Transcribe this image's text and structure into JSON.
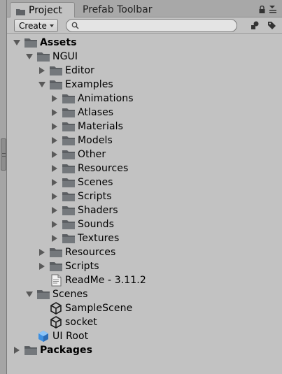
{
  "tabs": [
    {
      "label": "Project",
      "active": true
    },
    {
      "label": "Prefab Toolbar",
      "active": false
    }
  ],
  "toolbar": {
    "create_label": "Create",
    "search_placeholder": ""
  },
  "tree": [
    {
      "label": "Assets",
      "depth": 0,
      "expander": "down",
      "icon": "folder-icon",
      "bold": true
    },
    {
      "label": "NGUI",
      "depth": 1,
      "expander": "down",
      "icon": "folder-icon"
    },
    {
      "label": "Editor",
      "depth": 2,
      "expander": "right",
      "icon": "folder-icon"
    },
    {
      "label": "Examples",
      "depth": 2,
      "expander": "down",
      "icon": "folder-icon"
    },
    {
      "label": "Animations",
      "depth": 3,
      "expander": "right",
      "icon": "folder-icon"
    },
    {
      "label": "Atlases",
      "depth": 3,
      "expander": "right",
      "icon": "folder-icon"
    },
    {
      "label": "Materials",
      "depth": 3,
      "expander": "right",
      "icon": "folder-icon"
    },
    {
      "label": "Models",
      "depth": 3,
      "expander": "right",
      "icon": "folder-icon"
    },
    {
      "label": "Other",
      "depth": 3,
      "expander": "right",
      "icon": "folder-icon"
    },
    {
      "label": "Resources",
      "depth": 3,
      "expander": "right",
      "icon": "folder-icon"
    },
    {
      "label": "Scenes",
      "depth": 3,
      "expander": "right",
      "icon": "folder-icon"
    },
    {
      "label": "Scripts",
      "depth": 3,
      "expander": "right",
      "icon": "folder-icon"
    },
    {
      "label": "Shaders",
      "depth": 3,
      "expander": "right",
      "icon": "folder-icon"
    },
    {
      "label": "Sounds",
      "depth": 3,
      "expander": "right",
      "icon": "folder-icon"
    },
    {
      "label": "Textures",
      "depth": 3,
      "expander": "right",
      "icon": "folder-icon"
    },
    {
      "label": "Resources",
      "depth": 2,
      "expander": "right",
      "icon": "folder-icon"
    },
    {
      "label": "Scripts",
      "depth": 2,
      "expander": "right",
      "icon": "folder-icon"
    },
    {
      "label": "ReadMe - 3.11.2",
      "depth": 2,
      "expander": "none",
      "icon": "text-file-icon"
    },
    {
      "label": "Scenes",
      "depth": 1,
      "expander": "down",
      "icon": "folder-icon"
    },
    {
      "label": "SampleScene",
      "depth": 2,
      "expander": "none",
      "icon": "unity-scene-icon"
    },
    {
      "label": "socket",
      "depth": 2,
      "expander": "none",
      "icon": "unity-scene-icon"
    },
    {
      "label": "UI Root",
      "depth": 1,
      "expander": "none",
      "icon": "prefab-cube-icon"
    },
    {
      "label": "Packages",
      "depth": 0,
      "expander": "right",
      "icon": "folder-icon",
      "bold": true
    }
  ],
  "colors": {
    "background": "#c2c2c2",
    "folder": "#5f6266",
    "prefab": "#3d8fe0"
  }
}
